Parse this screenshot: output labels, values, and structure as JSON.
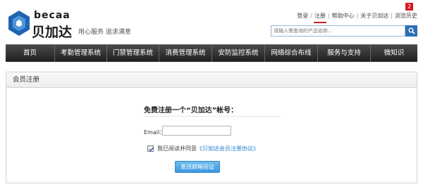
{
  "brand": {
    "logo_en": "becaa",
    "logo_cn": "贝加达",
    "slogan": "用心服务 追求满意"
  },
  "top_links": {
    "login": "登录",
    "slash": "/",
    "register": "注册",
    "help": "帮助中心",
    "about": "关于贝加达",
    "history": "浏览历史",
    "history_count": "2"
  },
  "search": {
    "placeholder": "请输入需查询的产品名称…"
  },
  "nav": {
    "items": [
      {
        "label": "首页"
      },
      {
        "label": "考勤管理系统"
      },
      {
        "label": "门禁管理系统"
      },
      {
        "label": "消费管理系统"
      },
      {
        "label": "安防监控系统"
      },
      {
        "label": "网络综合布线"
      },
      {
        "label": "服务与支持"
      },
      {
        "label": "微知识"
      }
    ]
  },
  "panel": {
    "title": "会员注册",
    "form_title": "免费注册一个“贝加达”帐号：",
    "email_label": "Email：",
    "email_value": "",
    "agree_checked": true,
    "agree_text": "我已阅读并同意",
    "agree_link": "《贝加达会员注册协议》",
    "submit_label": "发送邮箱验证"
  },
  "colors": {
    "nav_bg": "#2e2e2e",
    "accent_blue": "#2c6fb6",
    "link_blue": "#2a7fd0",
    "badge_red": "#d51a1a",
    "button_blue": "#4aa5e6"
  }
}
